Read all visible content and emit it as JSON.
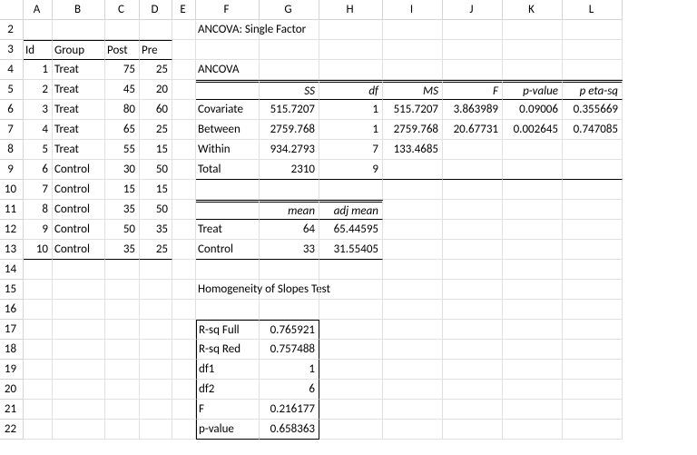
{
  "columns": [
    "A",
    "B",
    "C",
    "D",
    "E",
    "F",
    "G",
    "H",
    "I",
    "J",
    "K",
    "L"
  ],
  "rows": [
    "2",
    "3",
    "4",
    "5",
    "6",
    "7",
    "8",
    "9",
    "10",
    "11",
    "12",
    "13",
    "14",
    "15",
    "16",
    "17",
    "18",
    "19",
    "20",
    "21",
    "22"
  ],
  "dataHeaders": {
    "id": "Id",
    "group": "Group",
    "post": "Post",
    "pre": "Pre"
  },
  "data": [
    {
      "id": "1",
      "group": "Treat",
      "post": "75",
      "pre": "25"
    },
    {
      "id": "2",
      "group": "Treat",
      "post": "45",
      "pre": "20"
    },
    {
      "id": "3",
      "group": "Treat",
      "post": "80",
      "pre": "60"
    },
    {
      "id": "4",
      "group": "Treat",
      "post": "65",
      "pre": "25"
    },
    {
      "id": "5",
      "group": "Treat",
      "post": "55",
      "pre": "15"
    },
    {
      "id": "6",
      "group": "Control",
      "post": "30",
      "pre": "50"
    },
    {
      "id": "7",
      "group": "Control",
      "post": "15",
      "pre": "15"
    },
    {
      "id": "8",
      "group": "Control",
      "post": "35",
      "pre": "50"
    },
    {
      "id": "9",
      "group": "Control",
      "post": "50",
      "pre": "35"
    },
    {
      "id": "10",
      "group": "Control",
      "post": "35",
      "pre": "25"
    }
  ],
  "titles": {
    "ancovaSingle": "ANCOVA: Single Factor",
    "ancova": "ANCOVA",
    "homogeneity": "Homogeneity of Slopes Test"
  },
  "ancovaHeaders": {
    "ss": "SS",
    "df": "df",
    "ms": "MS",
    "f": "F",
    "pvalue": "p-value",
    "petasq": "p eta-sq"
  },
  "ancovaRows": {
    "covariate": {
      "label": "Covariate",
      "ss": "515.7207",
      "df": "1",
      "ms": "515.7207",
      "f": "3.863989",
      "pvalue": "0.09006",
      "petasq": "0.355669"
    },
    "between": {
      "label": "Between",
      "ss": "2759.768",
      "df": "1",
      "ms": "2759.768",
      "f": "20.67731",
      "pvalue": "0.002645",
      "petasq": "0.747085"
    },
    "within": {
      "label": "Within",
      "ss": "934.2793",
      "df": "7",
      "ms": "133.4685"
    },
    "total": {
      "label": "Total",
      "ss": "2310",
      "df": "9"
    }
  },
  "meansHeaders": {
    "mean": "mean",
    "adjmean": "adj mean"
  },
  "meansRows": {
    "treat": {
      "label": "Treat",
      "mean": "64",
      "adjmean": "65.44595"
    },
    "control": {
      "label": "Control",
      "mean": "33",
      "adjmean": "31.55405"
    }
  },
  "homog": {
    "rsqFull": {
      "label": "R-sq Full",
      "val": "0.765921"
    },
    "rsqRed": {
      "label": "R-sq Red",
      "val": "0.757488"
    },
    "df1": {
      "label": "df1",
      "val": "1"
    },
    "df2": {
      "label": "df2",
      "val": "6"
    },
    "f": {
      "label": "F",
      "val": "0.216177"
    },
    "pvalue": {
      "label": "p-value",
      "val": "0.658363"
    }
  }
}
